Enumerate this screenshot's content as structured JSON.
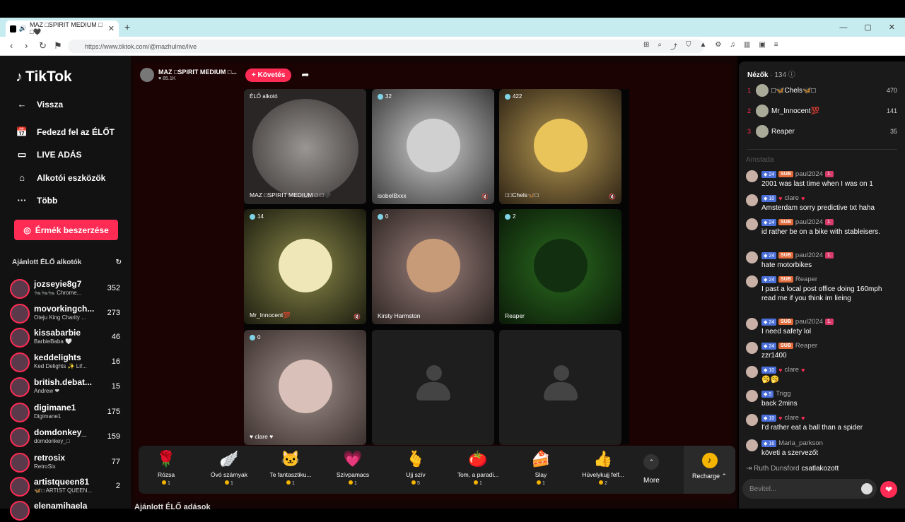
{
  "browser": {
    "tab_title": "MAZ □SPIRIT MEDIUM □ □🖤",
    "url": "https://www.tiktok.com/@mazhulme/live",
    "tab_close": "✕",
    "new_tab": "+",
    "win_min": "—",
    "win_max": "▢",
    "win_close": "✕"
  },
  "sidebar": {
    "logo": "TikTok",
    "nav": [
      {
        "icon": "←",
        "label": "Vissza"
      },
      {
        "icon": "📅",
        "label": "Fedezd fel az ÉLŐT"
      },
      {
        "icon": "▭",
        "label": "LIVE ADÁS"
      },
      {
        "icon": "⌂",
        "label": "Alkotói eszközök"
      },
      {
        "icon": "···",
        "label": "Több"
      }
    ],
    "coins_button": "Érmék beszerzése",
    "recommended_title": "Ajánlott ÉLŐ alkotók",
    "creators": [
      {
        "name": "jozseyie8g7",
        "sub": "🐜🐜🐜 Chrome...",
        "count": "352"
      },
      {
        "name": "movorkingch...",
        "sub": "Oteju King Charity ...",
        "count": "273"
      },
      {
        "name": "kissabarbie",
        "sub": "BarbieBaba 🤍",
        "count": "46"
      },
      {
        "name": "keddelights",
        "sub": "Ked Delights ✨ Lif...",
        "count": "16"
      },
      {
        "name": "british.debat...",
        "sub": "Andrew ❤",
        "count": "15"
      },
      {
        "name": "digimane1",
        "sub": "Digimane1",
        "count": "175"
      },
      {
        "name": "domdonkey_",
        "sub": "domdonkey_□",
        "count": "159"
      },
      {
        "name": "retrosix",
        "sub": "RetroSix",
        "count": "77"
      },
      {
        "name": "artistqueen81",
        "sub": "🦋□ ARTIST QUEEN...",
        "count": "2"
      },
      {
        "name": "elenamihaela",
        "sub": "",
        "count": ""
      }
    ]
  },
  "main": {
    "host_name": "MAZ □SPIRIT MEDIUM □...",
    "host_likes": "♥ 85.1K",
    "follow_button": "+ Követés",
    "share_icon": "➦",
    "bottom_heading": "Ajánlott ÉLŐ adások",
    "grid": [
      {
        "label": "MAZ □SPIRIT MEDIUM □ □🖤",
        "viewers": "",
        "top_label": "ÉLŐ alkotó",
        "muted": false
      },
      {
        "label": "isobelBxxx",
        "viewers": "32",
        "top_label": "",
        "muted": true
      },
      {
        "label": "□□Chels🦋□",
        "viewers": "422",
        "top_label": "",
        "muted": true
      },
      {
        "label": "Mr_Innocent💯",
        "viewers": "14",
        "top_label": "",
        "muted": true
      },
      {
        "label": "Kirsty Harmston",
        "viewers": "0",
        "top_label": "",
        "muted": false
      },
      {
        "label": "Reaper",
        "viewers": "2",
        "top_label": "",
        "muted": false
      },
      {
        "label": "♥ clare ♥",
        "viewers": "0",
        "top_label": "",
        "muted": false
      }
    ],
    "gifts": [
      {
        "icon": "🌹",
        "name": "Rózsa",
        "price": "1"
      },
      {
        "icon": "🪽",
        "name": "Óvó szárnyak",
        "price": "1"
      },
      {
        "icon": "🐱",
        "name": "Te fantasztiku...",
        "price": "1"
      },
      {
        "icon": "💗",
        "name": "Szívpamacs",
        "price": "1"
      },
      {
        "icon": "🫰",
        "name": "Ujj szív",
        "price": "5"
      },
      {
        "icon": "🍅",
        "name": "Tom, a paradi...",
        "price": "1"
      },
      {
        "icon": "🍰",
        "name": "Slay",
        "price": "1"
      },
      {
        "icon": "👍",
        "name": "Hüvelykujj felf...",
        "price": "2"
      }
    ],
    "more_label": "More",
    "recharge_label": "Recharge ⌃"
  },
  "chat": {
    "viewers_title": "Nézők",
    "viewers_count": "· 134 ⓘ",
    "top_viewers": [
      {
        "rank": "1",
        "name": "□🦋Chels🦋□",
        "score": "470"
      },
      {
        "rank": "2",
        "name": "Mr_Innocent💯",
        "score": "141"
      },
      {
        "rank": "3",
        "name": "Reaper",
        "score": "35"
      }
    ],
    "faded": "Amstada",
    "messages": [
      {
        "level": "24",
        "sub": "SUB",
        "user": "paul2024",
        "fan": "1.",
        "heart": false,
        "text": "2001 was last time when I was on 1"
      },
      {
        "level": "10",
        "sub": "",
        "user": "clare",
        "fan": "",
        "heart": true,
        "text": "Amsterdam sorry predictive txt haha"
      },
      {
        "level": "24",
        "sub": "SUB",
        "user": "paul2024",
        "fan": "1.",
        "heart": false,
        "text": "id rather be on a bike with stableisers."
      },
      {
        "level": "24",
        "sub": "SUB",
        "user": "paul2024",
        "fan": "1.",
        "heart": false,
        "text": "hate motorbikes"
      },
      {
        "level": "24",
        "sub": "SUB",
        "user": "Reaper",
        "fan": "",
        "heart": false,
        "text": "I past a local post office doing 160mph read me if you think im lieing"
      },
      {
        "level": "24",
        "sub": "SUB",
        "user": "paul2024",
        "fan": "1.",
        "heart": false,
        "text": "I need safety lol"
      },
      {
        "level": "24",
        "sub": "SUB",
        "user": "Reaper",
        "fan": "",
        "heart": false,
        "text": "zzr1400"
      },
      {
        "level": "10",
        "sub": "",
        "user": "clare",
        "fan": "",
        "heart": true,
        "text": "🥱🥱"
      },
      {
        "level": "5",
        "sub": "",
        "user": "Trigg",
        "fan": "",
        "heart": false,
        "text": "back 2mins"
      },
      {
        "level": "10",
        "sub": "",
        "user": "clare",
        "fan": "",
        "heart": true,
        "text": "I'd rather eat a ball than a spider"
      },
      {
        "level": "16",
        "sub": "",
        "user": "Maria_parkson",
        "fan": "",
        "heart": false,
        "text": "követi a szervezőt"
      }
    ],
    "join_user": "Ruth Dunsford",
    "join_text": "csatlakozott",
    "input_placeholder": "Bevitel..."
  },
  "colors": {
    "accent": "#fe2c55",
    "panel": "#1a1a1a",
    "stage": "#1b0303"
  }
}
